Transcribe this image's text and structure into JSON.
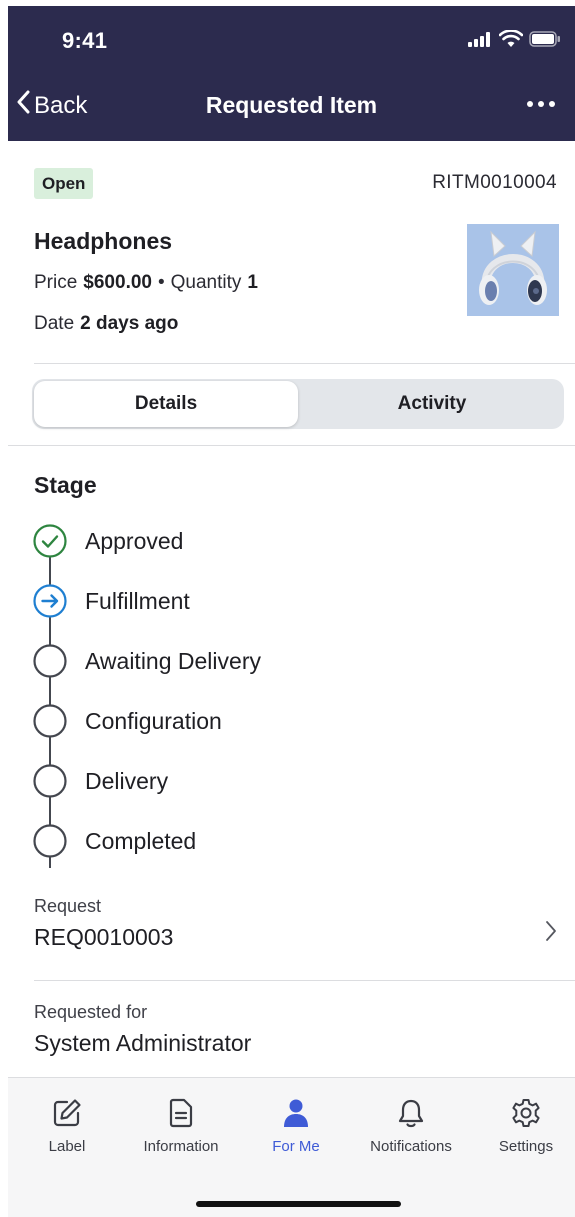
{
  "status_bar": {
    "time": "9:41",
    "icons": [
      "signal-icon",
      "wifi-icon",
      "battery-icon"
    ]
  },
  "nav": {
    "back_label": "Back",
    "title": "Requested Item",
    "more_icon": "more-icon"
  },
  "item": {
    "status": "Open",
    "number": "RITM0010004",
    "name": "Headphones",
    "price_label": "Price",
    "price": "$600.00",
    "separator": "•",
    "quantity_label": "Quantity",
    "quantity": "1",
    "date_label": "Date",
    "date": "2 days ago",
    "thumbnail": "headphones-image"
  },
  "tabs": [
    {
      "label": "Details",
      "active": true
    },
    {
      "label": "Activity",
      "active": false
    }
  ],
  "stage": {
    "title": "Stage",
    "items": [
      {
        "label": "Approved",
        "state": "complete"
      },
      {
        "label": "Fulfillment",
        "state": "current"
      },
      {
        "label": "Awaiting Delivery",
        "state": "pending"
      },
      {
        "label": "Configuration",
        "state": "pending"
      },
      {
        "label": "Delivery",
        "state": "pending"
      },
      {
        "label": "Completed",
        "state": "pending"
      }
    ]
  },
  "request": {
    "label": "Request",
    "value": "REQ0010003"
  },
  "requested_for": {
    "label": "Requested for",
    "value": "System Administrator"
  },
  "tabbar": {
    "items": [
      {
        "label": "Label",
        "icon": "edit-icon",
        "active": false
      },
      {
        "label": "Information",
        "icon": "document-icon",
        "active": false
      },
      {
        "label": "For Me",
        "icon": "person-icon",
        "active": true
      },
      {
        "label": "Notifications",
        "icon": "bell-icon",
        "active": false
      },
      {
        "label": "Settings",
        "icon": "gear-icon",
        "active": false
      }
    ]
  },
  "colors": {
    "header_bg": "#2c2b4e",
    "complete": "#2e8540",
    "current": "#1f7fd1",
    "active_tab": "#3f5bd6",
    "badge_bg": "#d9efdc"
  }
}
